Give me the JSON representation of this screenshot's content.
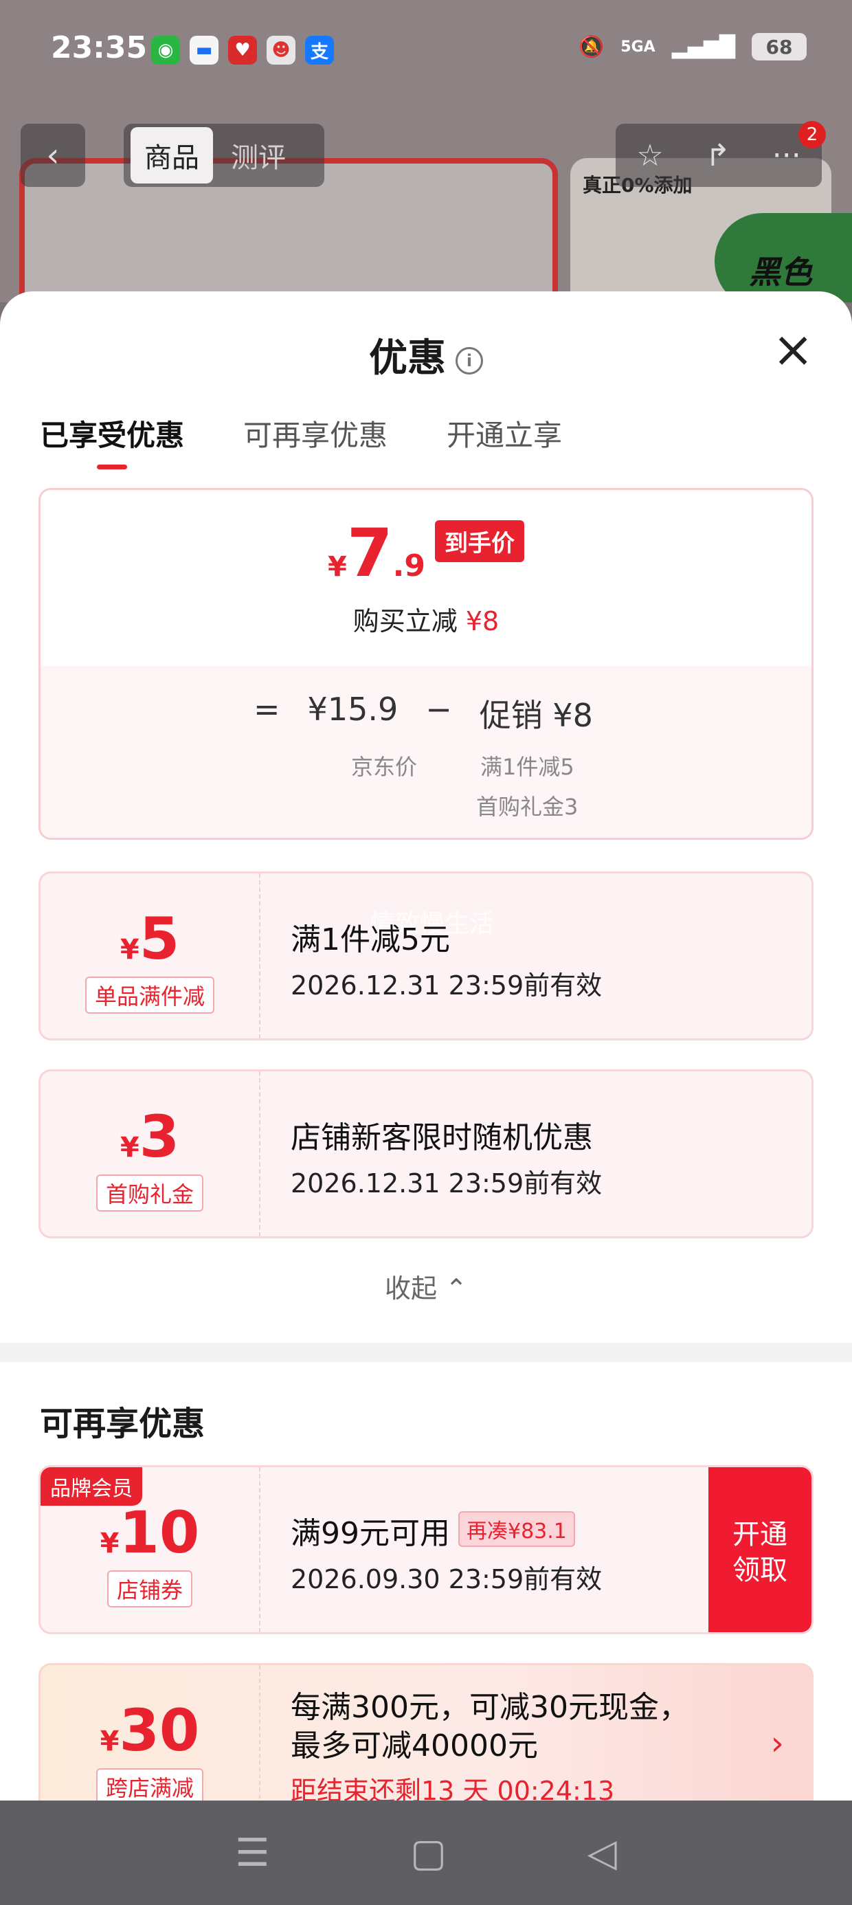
{
  "status_bar": {
    "time": "23:35",
    "network": "5GA",
    "battery": "68"
  },
  "background_page": {
    "tabs": [
      "商品",
      "测评"
    ],
    "badge_count": "2",
    "right_card_title": "真正0%添加",
    "green_label": "黑色"
  },
  "sheet": {
    "title": "优惠",
    "tabs": [
      "已享受优惠",
      "可再享优惠",
      "开通立享"
    ],
    "summary": {
      "yen": "¥",
      "price_int": "7",
      "price_dec": ".9",
      "final_tag": "到手价",
      "reduce_text": "购买立减",
      "reduce_amount": "¥8",
      "equals": "=",
      "jd_price": "¥15.9",
      "minus": "−",
      "promo": "促销 ¥8",
      "jd_price_label": "京东价",
      "promo_detail_1": "满1件减5",
      "promo_detail_2": "首购礼金3"
    },
    "coupons_enjoyed": [
      {
        "yen": "¥",
        "amount": "5",
        "label": "单品满件减",
        "title": "满1件减5元",
        "valid": "2026.12.31 23:59前有效",
        "watermark": "情致慢生活"
      },
      {
        "yen": "¥",
        "amount": "3",
        "label": "首购礼金",
        "title": "店铺新客限时随机优惠",
        "valid": "2026.12.31 23:59前有效"
      }
    ],
    "collapse_label": "收起",
    "more_section_title": "可再享优惠",
    "coupons_more": [
      {
        "vip_tag": "品牌会员",
        "yen": "¥",
        "amount": "10",
        "label": "店铺券",
        "title": "满99元可用",
        "again": "再凑¥83.1",
        "valid": "2026.09.30 23:59前有效",
        "button": "开通领取"
      },
      {
        "yen": "¥",
        "amount": "30",
        "label": "跨店满减",
        "line1": "每满300元，可减30元现金，",
        "line2": "最多可减40000元",
        "countdown": "距结束还剩13 天 00:24:13"
      }
    ]
  },
  "colors": {
    "accent": "#e8222e",
    "coupon_bg": "#fdf3f4",
    "button_red": "#f01b30"
  }
}
